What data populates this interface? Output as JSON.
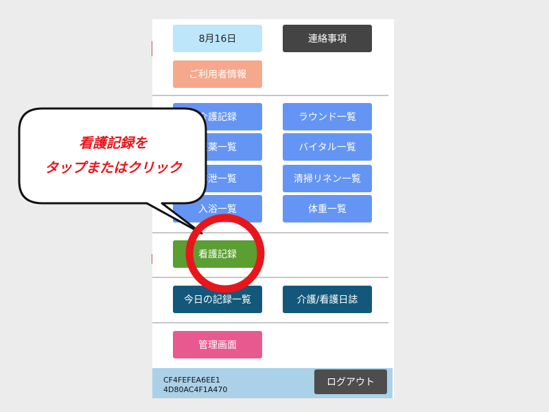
{
  "date_button": "8月16日",
  "notice_button": "連絡事項",
  "user_info_button": "ご利用者情報",
  "menu": {
    "care_record": "介護記録",
    "round_list": "ラウンド一覧",
    "medication_list": "服薬一覧",
    "vital_list": "バイタル一覧",
    "excretion_list": "排泄一覧",
    "cleaning_list": "清掃リネン一覧",
    "bath_list": "入浴一覧",
    "weight_list": "体重一覧"
  },
  "nursing_record_button": "看護記録",
  "today_records_button": "今日の記録一覧",
  "care_nursing_diary_button": "介護/看護日誌",
  "admin_button": "管理画面",
  "footer": {
    "device_id_line1": "CF4FEFEA6EE1",
    "device_id_line2": "4D80AC4F1A470",
    "logout_button": "ログアウト"
  },
  "callout": {
    "line1": "看護記録を",
    "line2": "タップまたはクリック"
  },
  "colors": {
    "primary_blue": "#6495f5",
    "nursing_green": "#5b9e31",
    "teal": "#13587a",
    "admin_pink": "#e85a8f",
    "highlight_red": "#e8161b"
  }
}
